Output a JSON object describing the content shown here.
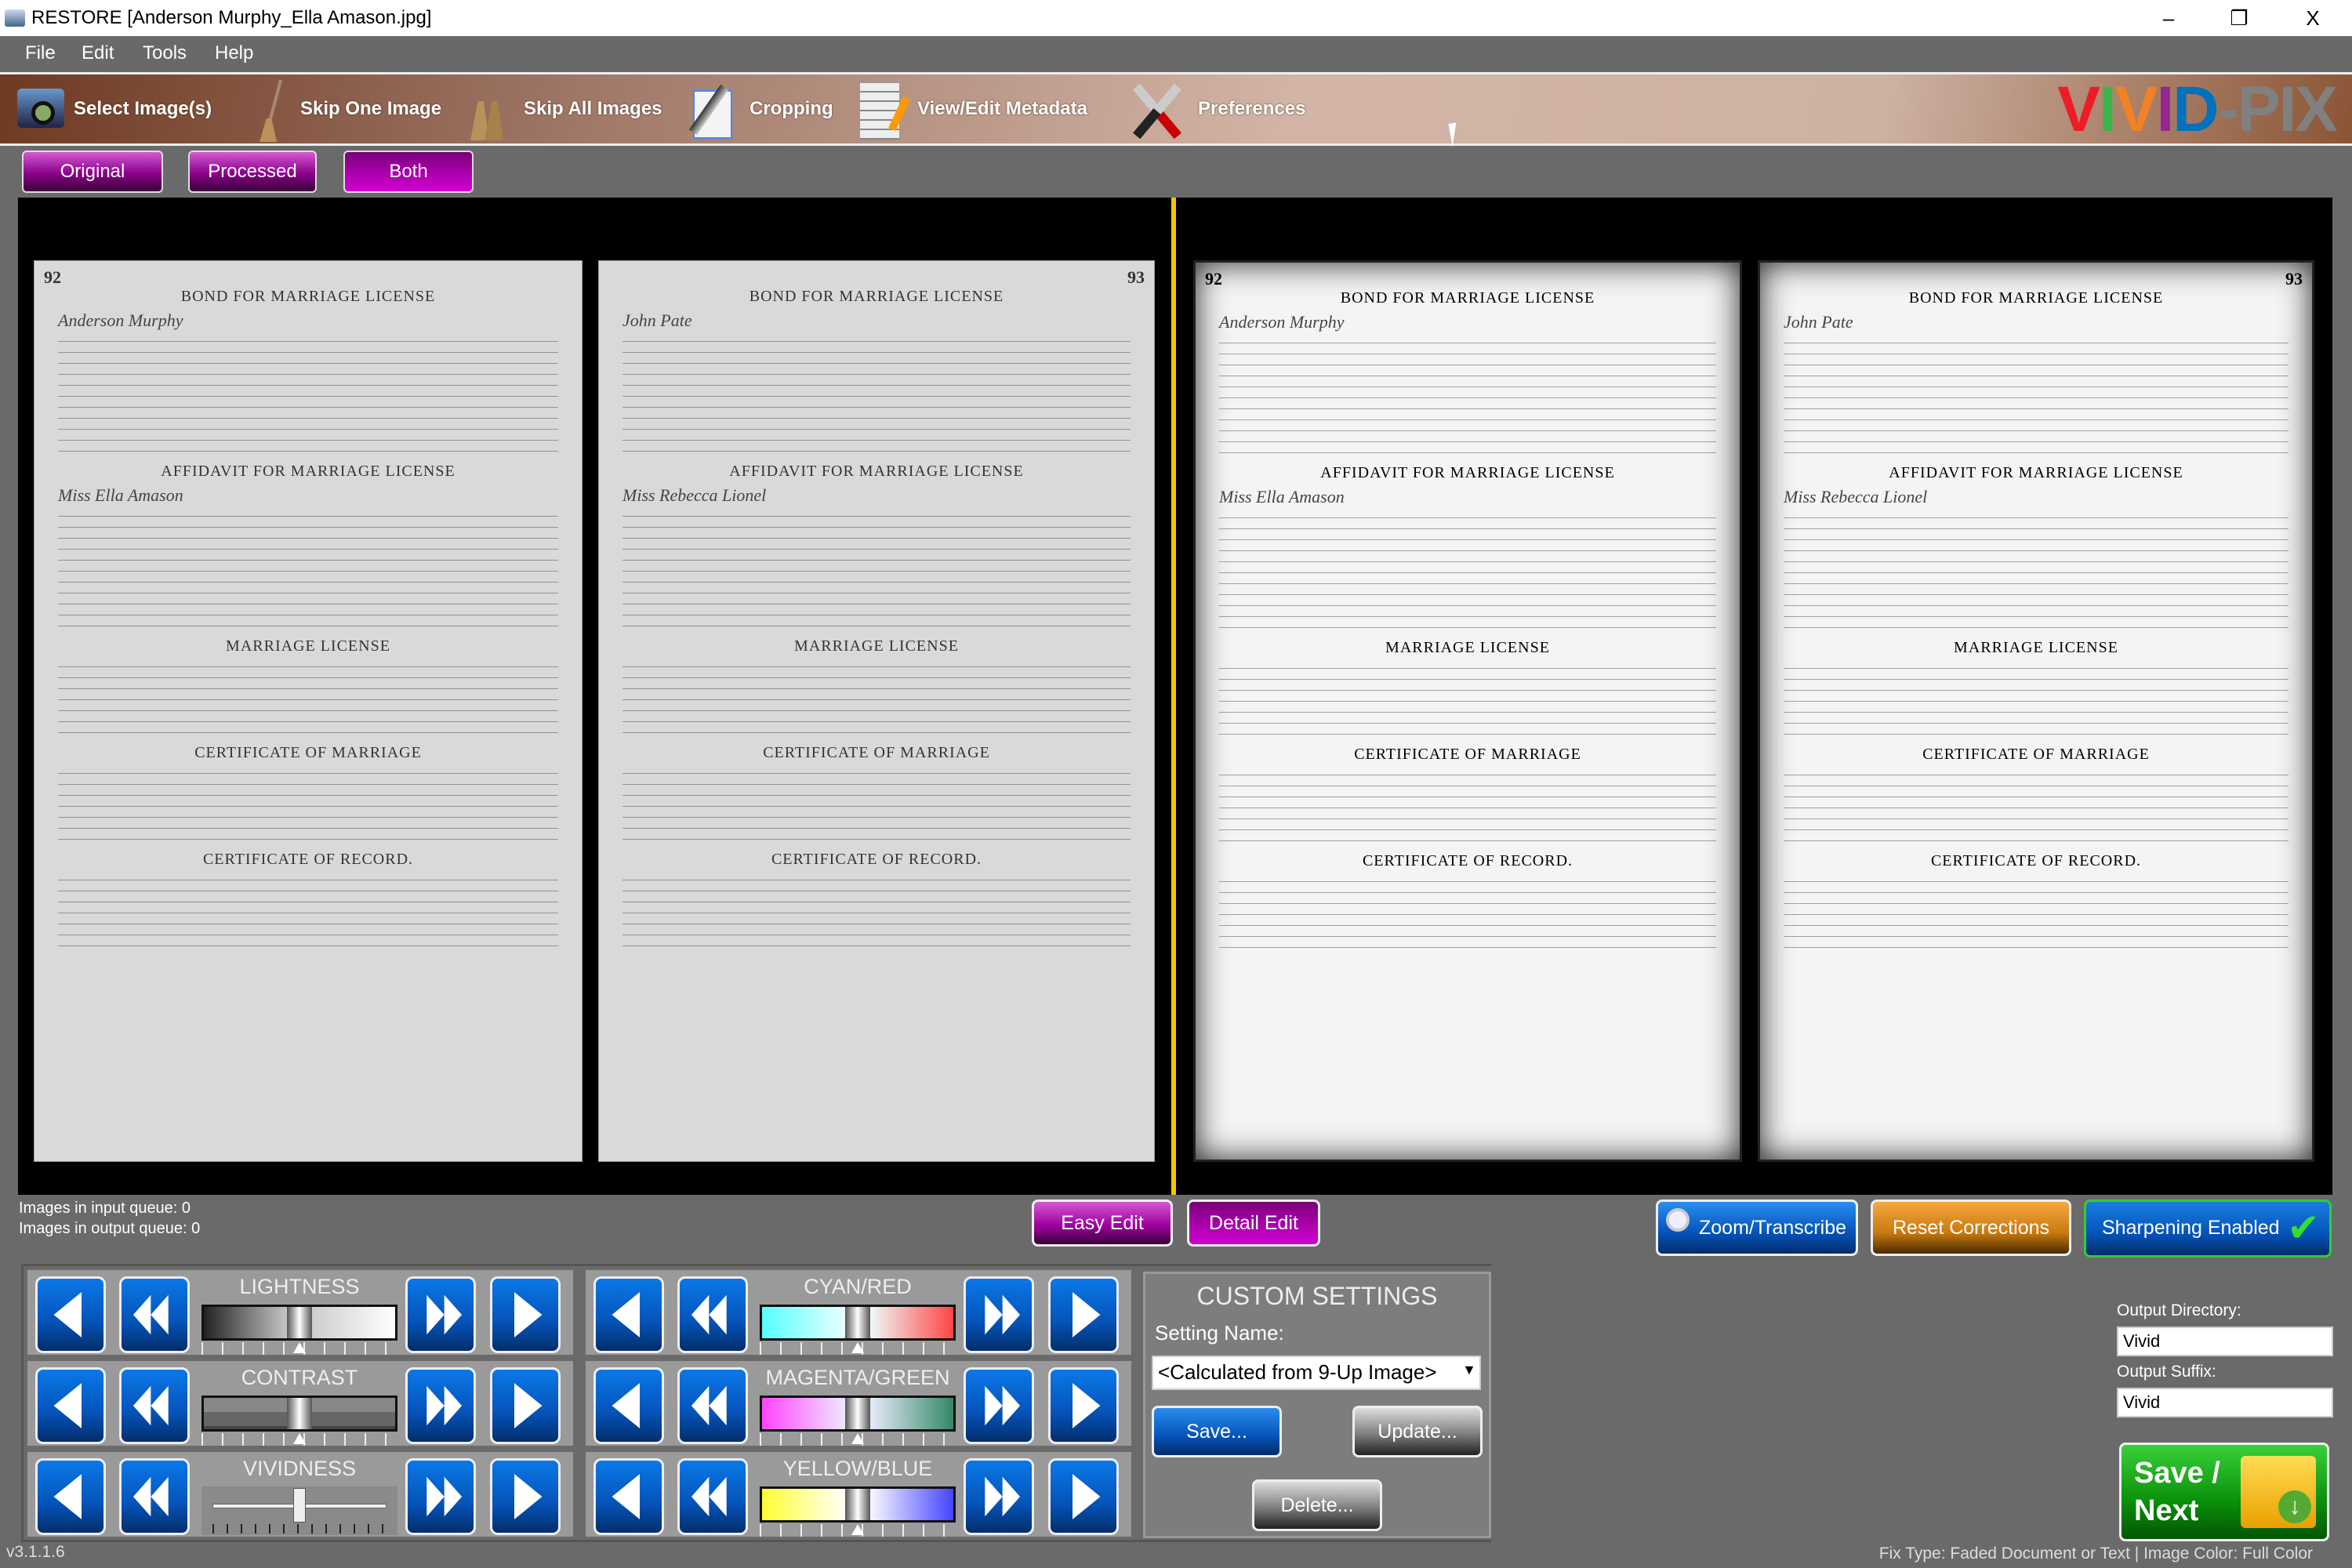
{
  "window": {
    "title": "RESTORE  [Anderson Murphy_Ella Amason.jpg]",
    "minimize": "–",
    "restore": "❐",
    "close": "X"
  },
  "menu": [
    "File",
    "Edit",
    "Tools",
    "Help"
  ],
  "toolbar": [
    {
      "label": "Select Image(s)",
      "icon": "camera-photos-icon"
    },
    {
      "label": "Skip One Image",
      "icon": "broom-icon"
    },
    {
      "label": "Skip All Images",
      "icon": "two-brooms-icon"
    },
    {
      "label": "Cropping",
      "icon": "crop-icon"
    },
    {
      "label": "View/Edit Metadata",
      "icon": "document-pencil-icon"
    },
    {
      "label": "Preferences",
      "icon": "tools-icon"
    }
  ],
  "logo": "VIVID-PIX",
  "logo_colors": [
    "#ee1c25",
    "#3cb54a",
    "#f08224",
    "#92278f",
    "#0072bc",
    "#0072bc",
    "#808080",
    "#808080",
    "#808080"
  ],
  "view_modes": {
    "original": "Original",
    "processed": "Processed",
    "both": "Both",
    "selected": "Both"
  },
  "document": {
    "left_page_number": "92",
    "right_page_number": "93",
    "sections": [
      "BOND FOR MARRIAGE LICENSE",
      "AFFIDAVIT FOR MARRIAGE LICENSE",
      "MARRIAGE LICENSE",
      "CERTIFICATE OF MARRIAGE",
      "CERTIFICATE OF RECORD."
    ],
    "left_names": [
      "Anderson Murphy",
      "Miss Ella Amason"
    ],
    "right_names": [
      "John Pate",
      "Miss Rebecca Lionel"
    ]
  },
  "queue": {
    "input": "Images in input queue:  0",
    "output": "Images in output queue: 0"
  },
  "edit_modes": {
    "easy": "Easy Edit",
    "detail": "Detail Edit"
  },
  "actions": {
    "zoom": "Zoom/Transcribe",
    "reset": "Reset Corrections",
    "sharpening": "Sharpening Enabled",
    "sharpening_on": true
  },
  "adjustments": [
    {
      "label": "LIGHTNESS",
      "value": 0,
      "colors": [
        "#222",
        "#ccc",
        "#fff"
      ]
    },
    {
      "label": "CONTRAST",
      "value": 0,
      "colors": [
        "#888",
        "#777",
        "#111"
      ]
    },
    {
      "label": "VIVIDNESS",
      "value": 0,
      "colors": []
    },
    {
      "label": "CYAN/RED",
      "value": 0,
      "colors": [
        "#5ff",
        "#eff",
        "#f44"
      ]
    },
    {
      "label": "MAGENTA/GREEN",
      "value": 0,
      "colors": [
        "#f4f",
        "#eef",
        "#386"
      ]
    },
    {
      "label": "YELLOW/BLUE",
      "value": 0,
      "colors": [
        "#ff3",
        "#fff",
        "#44f"
      ]
    }
  ],
  "custom": {
    "title": "CUSTOM SETTINGS",
    "setting_label": "Setting Name:",
    "setting_value": "<Calculated from 9-Up Image>",
    "save": "Save...",
    "update": "Update...",
    "delete": "Delete..."
  },
  "output": {
    "dir_label": "Output Directory:",
    "dir_value": "Vivid",
    "suffix_label": "Output Suffix:",
    "suffix_value": "Vivid"
  },
  "save_next": {
    "line1": "Save /",
    "line2": "Next"
  },
  "footer": {
    "version": "v3.1.1.6",
    "status": "Fix Type:  Faded Document or Text | Image Color: Full Color"
  }
}
